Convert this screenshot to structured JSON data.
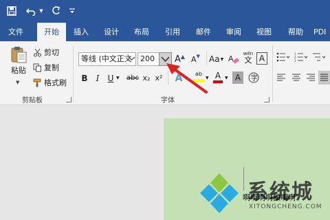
{
  "quick_access": {
    "icons": [
      "save-icon",
      "undo-icon",
      "redo-icon",
      "customize-icon"
    ]
  },
  "tabs": [
    {
      "label": "文件",
      "active": false
    },
    {
      "label": "开始",
      "active": true
    },
    {
      "label": "插入",
      "active": false
    },
    {
      "label": "设计",
      "active": false
    },
    {
      "label": "布局",
      "active": false
    },
    {
      "label": "引用",
      "active": false
    },
    {
      "label": "邮件",
      "active": false
    },
    {
      "label": "审阅",
      "active": false
    },
    {
      "label": "视图",
      "active": false
    },
    {
      "label": "帮助",
      "active": false
    },
    {
      "label": "PDI",
      "active": false
    }
  ],
  "clipboard": {
    "paste_label": "粘贴",
    "cut_label": "剪切",
    "copy_label": "复制",
    "format_painter_label": "格式刷",
    "group_label": "剪贴板"
  },
  "font": {
    "font_name": "等线 (中文正文",
    "font_size": "200",
    "group_label": "字体",
    "bold": "B",
    "italic": "I",
    "underline": "U",
    "strikethrough": "abc",
    "subscript": "x₂",
    "superscript": "x²",
    "grow": "A",
    "shrink": "A",
    "change_case": "Aa",
    "highlight": "ab",
    "font_color": "A",
    "char_shading": "A",
    "char_border": "A",
    "phonetic": "wén"
  },
  "document": {
    "text": "啊啊啊啊额啊啊"
  },
  "watermark": {
    "cn": "系统城",
    "en": "XITONGCHENG.COM"
  },
  "colors": {
    "title_bar": "#2b579a",
    "ribbon_bg": "#f3f3f3",
    "page_bg": "#c5e0b4",
    "arrow": "#e02020",
    "highlight_yellow": "#ffff00",
    "font_color_red": "#e00000"
  }
}
